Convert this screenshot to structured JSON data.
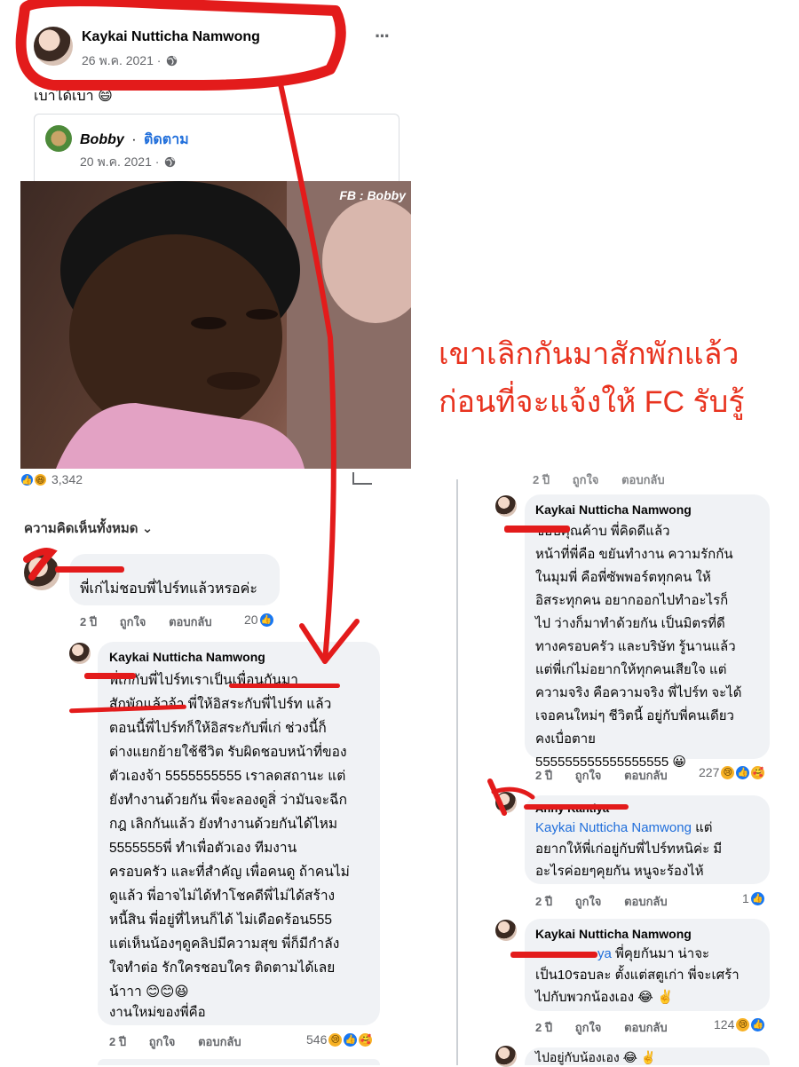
{
  "post": {
    "author": "Kaykai Nutticha Namwong",
    "date": "26 พ.ค. 2021 ·",
    "more": "···",
    "caption": "เบาได้เบา 😄"
  },
  "shared": {
    "author": "Bobby",
    "separator": "·",
    "follow": "ติดตาม",
    "date": "20 พ.ค. 2021 ·",
    "watermark": "FB : Bobby"
  },
  "annotation": {
    "line1": "เขาเลิกกันมาสักพักแล้ว",
    "line2": "ก่อนที่จะแจ้งให้ FC รับรู้"
  },
  "left": {
    "reaction_count": "3,342",
    "all_comments": "ความคิดเห็นทั้งหมด",
    "comment1": {
      "text": "พี่เก่ไม่ชอบพี่ไปร์ทแล้วหรอค่ะ",
      "time": "2 ปี",
      "like": "ถูกใจ",
      "reply": "ตอบกลับ",
      "count": "20"
    },
    "reply1": {
      "author": "Kaykai Nutticha Namwong",
      "text": "พี่เก่กับพี่ไปร์ทเราเป็นเพื่อนกันมา\nสักพักแล้วจ้า พี่ให้อิสระกับพี่ไปร์ท แล้ว\nตอนนี้พี่ไปร์ทก็ให้อิสระกับพี่เก่ ช่วงนี้ก็\nต่างแยกย้ายใช้ชีวิต รับผิดชอบหน้าที่ของ\nตัวเองจ้า 5555555555 เราลดสถานะ แต่\nยังทำงานด้วยกัน พี่จะลองดูสิ่ ว่ามันจะฉีก\nกฎ เลิกกันแล้ว ยังทำงานด้วยกันได้ไหม\n5555555พี่ ทำเพื่อตัวเอง ทีมงาน\nครอบครัว และที่สำคัญ เพื่อคนดู ถ้าคนไม่\nดูแล้ว พี่อาจไม่ได้ทำโชคดีพี่ไม่ได้สร้าง\nหนี้สิน พี่อยู่ที่ไหนก็ได้ ไม่เดือดร้อน555\nแต่เห็นน้องๆดูคลิปมีความสุข พี่ก็มีกำลัง\nใจทำต่อ รักใครชอบใคร ติดตามได้เลย\nน้าาา 😊😊😆",
      "text2": "งานใหม่ของพี่คือ",
      "time": "2 ปี",
      "like": "ถูกใจ",
      "reply": "ตอบกลับ",
      "count": "546"
    }
  },
  "right": {
    "top_actions": {
      "time": "2 ปี",
      "like": "ถูกใจ",
      "reply": "ตอบกลับ"
    },
    "c1": {
      "author": "Kaykai Nutticha Namwong",
      "text": "ขอบคุณค้าบ พี่คิดดีแล้ว\nหน้าที่พี่คือ ขยันทำงาน ความรักกัน\nในมุมพี่ คือพี่ซัพพอร์ตทุกคน  ให้\nอิสระทุกคน อยากออกไปทำอะไรก็\nไป ว่างก็มาทำด้วยกัน เป็นมิตรที่ดี\nทางครอบครัว และบริษัท รู้นานแล้ว\nแต่พี่เก่ไม่อยากให้ทุกคนเสียใจ แต่\nความจริง คือความจริง พี่ไปร์ท จะได้\nเจอคนใหม่ๆ ชีวิตนี้ อยู่กับพี่คนเดียว\nคงเบื่อตาย\n555555555555555555 😀",
      "time": "2 ปี",
      "like": "ถูกใจ",
      "reply": "ตอบกลับ",
      "count": "227"
    },
    "c2": {
      "author": "Anny Kantiya",
      "mention": "Kaykai Nutticha Namwong",
      "text_head": " แต่",
      "text": "อยากให้พี่เก่อยู่กับพี่ไปร์ทหนิค่ะ  มี\nอะไรค่อยๆคุยกัน  หนูจะร้องไห้",
      "time": "2 ปี",
      "like": "ถูกใจ",
      "reply": "ตอบกลับ",
      "count": "1"
    },
    "c3": {
      "author": "Kaykai Nutticha Namwong",
      "mention": "ya",
      "text_head": " พี่คุยกันมา น่าจะ",
      "text": "เป็น10รอบละ ตั้งแต่สตูเก่า พี่จะเศร้า\nไปกับพวกน้องเอง 😂 ✌️",
      "time": "2 ปี",
      "like": "ถูกใจ",
      "reply": "ตอบกลับ",
      "count": "124"
    },
    "c4_partial": "ไปอยู่กับน้องเอง 😂 ✌️"
  },
  "colors": {
    "annotation": "#e8331f",
    "link": "#216fdb",
    "marker": "#e31b1b"
  },
  "icons": [
    "globe-icon",
    "more-icon",
    "like-icon",
    "haha-icon",
    "sad-icon",
    "care-icon",
    "share-icon",
    "chevron-down-icon"
  ]
}
